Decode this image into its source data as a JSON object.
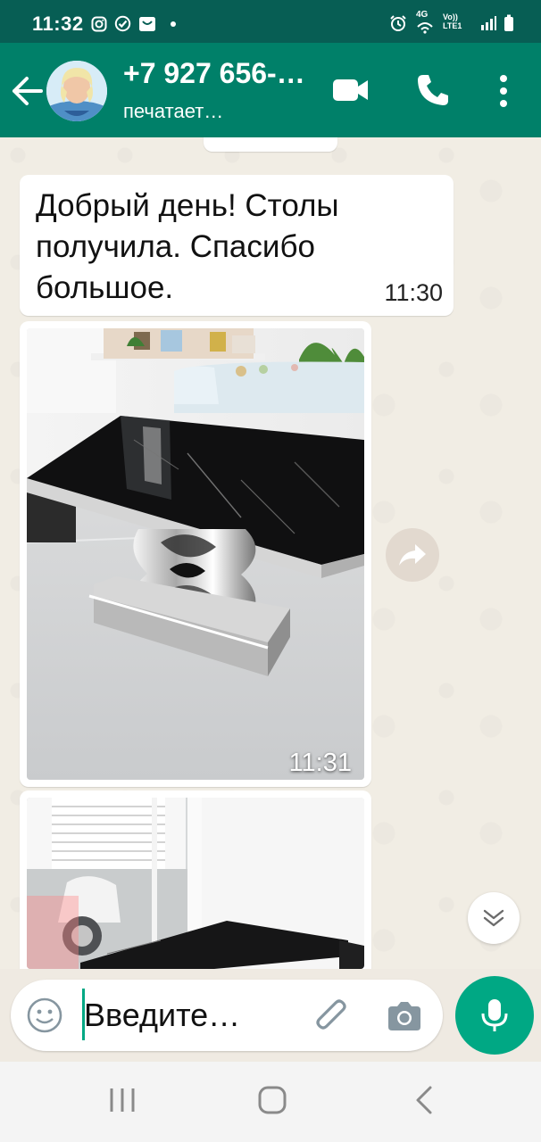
{
  "status_bar": {
    "time": "11:32",
    "left_icons": [
      "instagram-icon",
      "check-circle-icon",
      "inbox-icon"
    ],
    "right_icons": [
      "alarm-icon",
      "wifi-4g-icon",
      "volte-lte-icon",
      "signal-icon",
      "battery-icon"
    ],
    "network_top": "4G",
    "network_bottom": "Vo)) LTE1"
  },
  "header": {
    "contact_name": "+7 927 656-…",
    "contact_status": "печатает…",
    "icons": [
      "back-arrow-icon",
      "video-call-icon",
      "phone-icon",
      "more-vert-icon"
    ],
    "colors": {
      "app_bar": "#008069",
      "status_bar": "#075e54"
    }
  },
  "messages": [
    {
      "type": "text",
      "text": "Добрый день! Столы получила. Спасибо большое.",
      "time": "11:30"
    },
    {
      "type": "image",
      "description_icon": "photo-table-marble",
      "time": "11:31"
    },
    {
      "type": "image",
      "description_icon": "photo-table-window",
      "time": ""
    }
  ],
  "composer": {
    "placeholder": "Введите…",
    "icons": [
      "emoji-icon",
      "attach-icon",
      "camera-icon",
      "mic-icon"
    ],
    "accent": "#00a884"
  },
  "nav": {
    "icons": [
      "recent-apps-icon",
      "home-icon",
      "back-icon"
    ]
  }
}
